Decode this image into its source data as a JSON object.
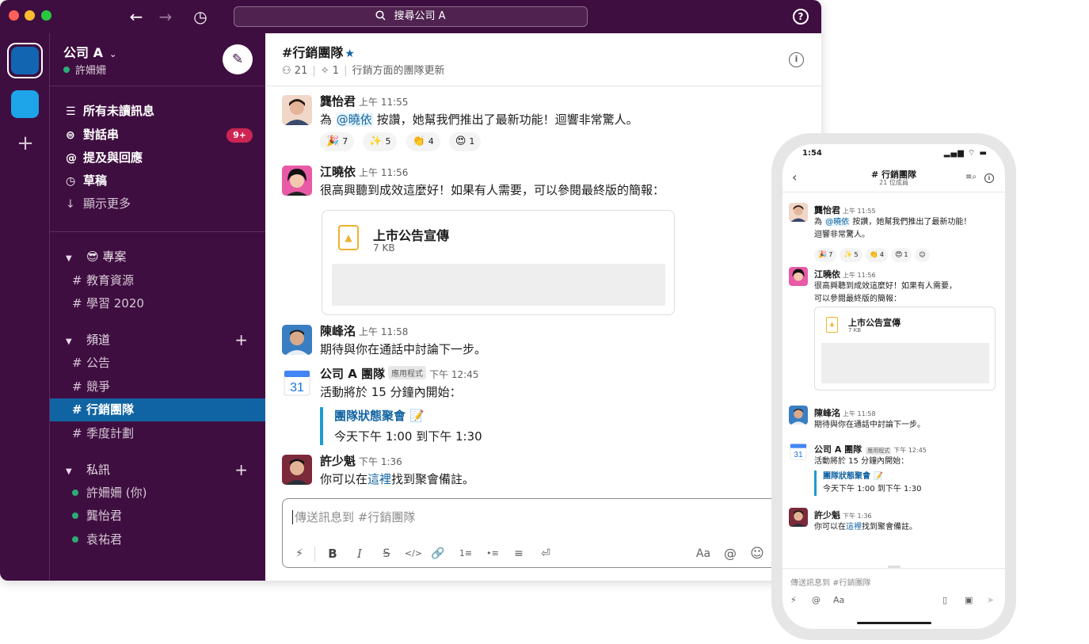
{
  "titlebar": {
    "search_placeholder": "搜尋公司 A",
    "back_icon": "←",
    "forward_icon": "→",
    "history_icon": "◷",
    "help_icon": "?"
  },
  "workspace": {
    "name": "公司 A",
    "user": "許姍姍",
    "compose_icon": "✎"
  },
  "nav": {
    "unreads": "所有未讀訊息",
    "threads": "對話串",
    "threads_badge": "9+",
    "mentions": "提及與回應",
    "drafts": "草稿",
    "show_more": "顯示更多"
  },
  "sections": {
    "projects": {
      "label": "專案",
      "emoji": "😎",
      "channels": [
        "教育資源",
        "學習 2020"
      ]
    },
    "channels": {
      "label": "頻道",
      "channels": [
        "公告",
        "競爭",
        "行銷團隊",
        "季度計劃"
      ]
    },
    "dms": {
      "label": "私訊",
      "people": [
        "許姍姍 (你)",
        "龔怡君",
        "袁祐君"
      ]
    }
  },
  "channel": {
    "name": "#行銷團隊",
    "members": "21",
    "pins": "1",
    "topic": "行銷方面的團隊更新"
  },
  "messages": [
    {
      "sender": "龔怡君",
      "time": "上午 11:55",
      "text_pre": "為 ",
      "mention": "@曉依",
      "text_post": " 按讚，她幫我們推出了最新功能！迴響非常驚人。",
      "reactions": [
        {
          "emoji": "🎉",
          "count": "7"
        },
        {
          "emoji": "✨",
          "count": "5"
        },
        {
          "emoji": "👏",
          "count": "4"
        },
        {
          "emoji": "😍",
          "count": "1"
        }
      ]
    },
    {
      "sender": "江曉依",
      "time": "上午 11:56",
      "text": "很高興聽到成效這麼好！如果有人需要，可以參閱最終版的簡報：",
      "file": {
        "name": "上市公告宣傳",
        "size": "7 KB"
      }
    },
    {
      "sender": "陳峰洺",
      "time": "上午 11:58",
      "text": "期待與你在通話中討論下一步。"
    },
    {
      "sender": "公司 A 團隊",
      "tag": "應用程式",
      "time": "下午 12:45",
      "calendar_day": "31",
      "text": "活動將於 15 分鐘內開始：",
      "event_title": "團隊狀態聚會",
      "event_emoji": "📝",
      "event_time": "今天下午 1:00 到下午 1:30"
    },
    {
      "sender": "許少魁",
      "time": "下午 1:36",
      "text_pre": "你可以在",
      "link": "這裡",
      "text_post": "找到聚會備註。"
    }
  ],
  "composer": {
    "placeholder": "傳送訊息到 #行銷團隊",
    "tools": [
      "⚡",
      "B",
      "I",
      "S",
      "</>",
      "🔗",
      "1≡",
      "•≡",
      "≡",
      "⏎",
      "Aa",
      "@",
      "☺"
    ]
  },
  "phone": {
    "clock": "1:54",
    "signal": "▂▄▆ ⌔ ▬",
    "title": "# 行銷團隊",
    "subtitle": "21 位成員",
    "msg1_text_pre": "為 ",
    "msg1_text_post": " 按讚，她幫我們推出了最新功能！",
    "msg1_text_line2": "迴響非常驚人。",
    "msg2_text_line1": "很高興聽到成效這麼好！如果有人需要，",
    "msg2_text_line2": "可以參閱最終版的簡報：",
    "composer_placeholder": "傳送訊息到 #行銷團隊",
    "tools_left": [
      "⚡",
      "@",
      "Aa"
    ],
    "tools_right": [
      "▯",
      "▣",
      "➤"
    ],
    "add_reaction_icon": "☺"
  },
  "colors": {
    "sidebar": "#3f0e40",
    "active_channel": "#1164a3",
    "badge": "#cd2553",
    "link": "#1264a3"
  }
}
